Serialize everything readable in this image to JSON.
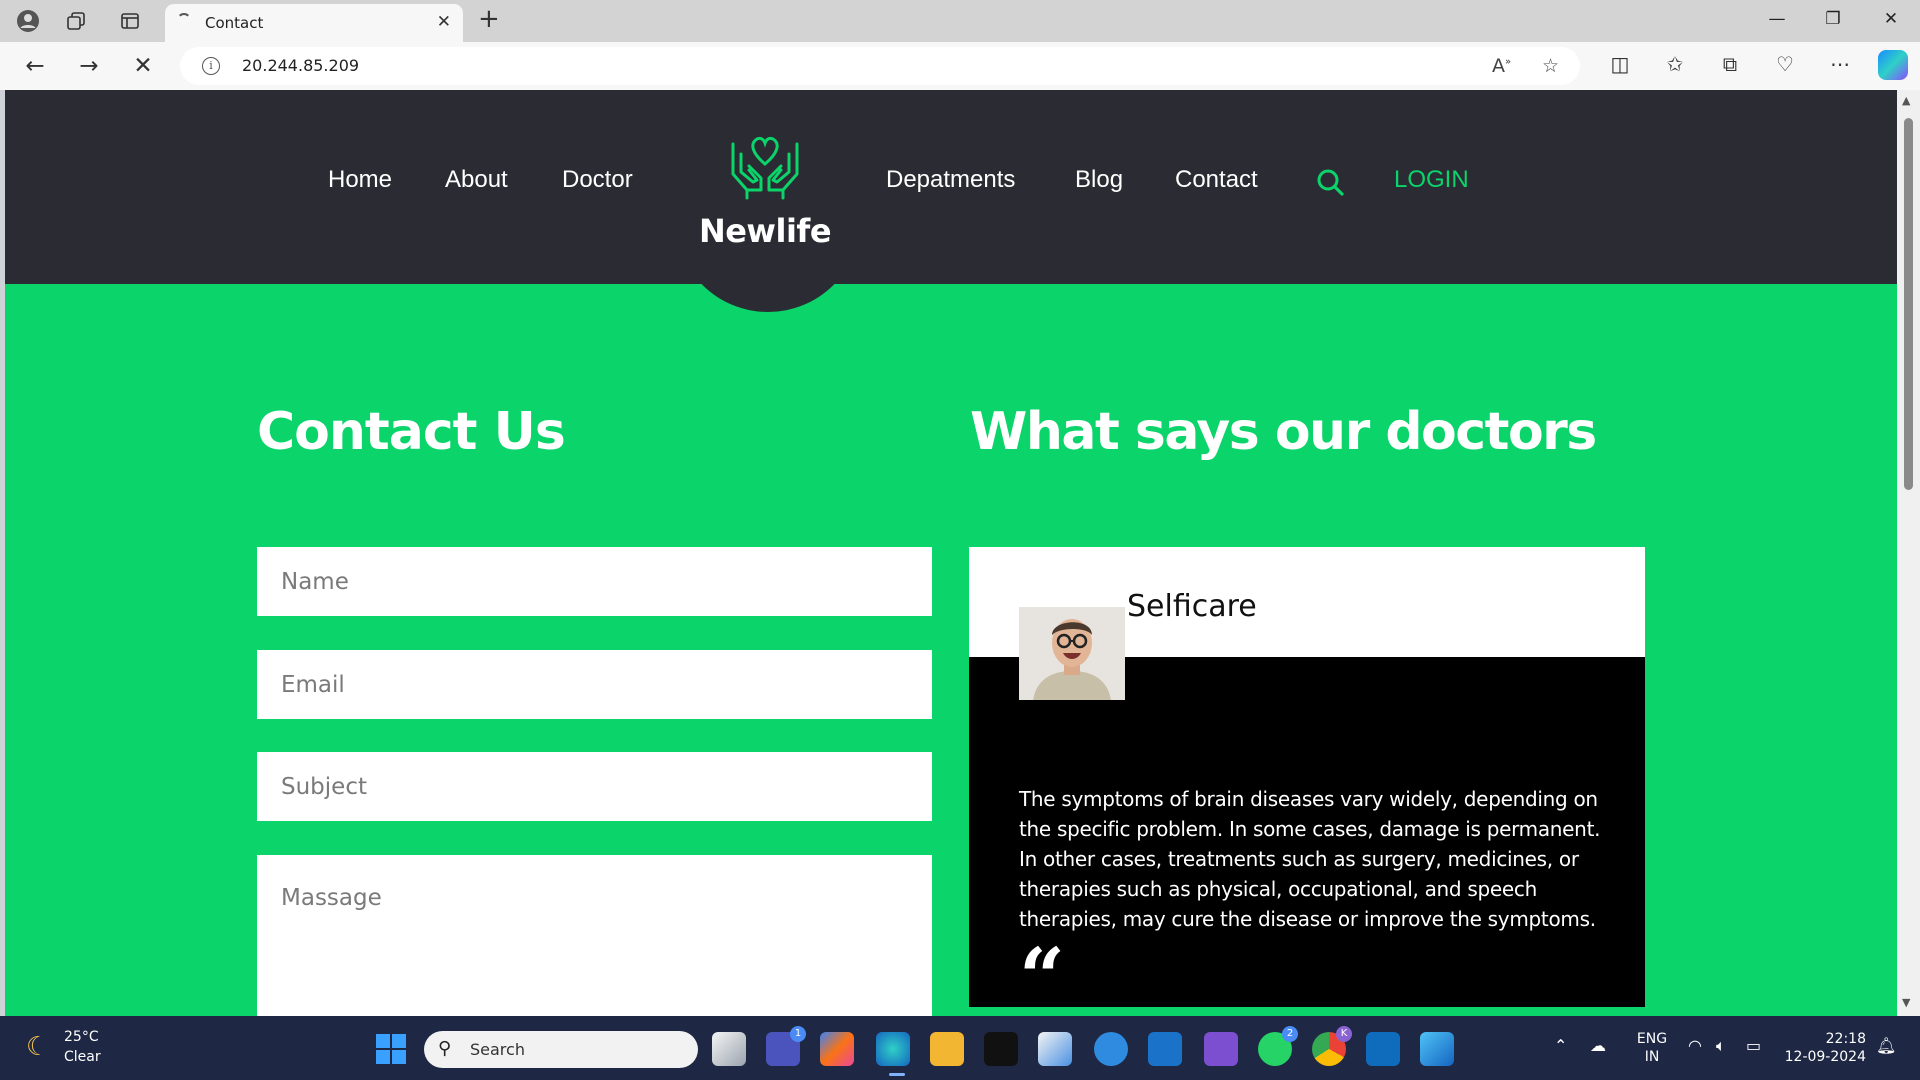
{
  "browser": {
    "tab_title": "Contact",
    "url": "20.244.85.209"
  },
  "site": {
    "logo_text": "Newlife",
    "nav_left": [
      "Home",
      "About",
      "Doctor"
    ],
    "nav_right": [
      "Depatments",
      "Blog",
      "Contact"
    ],
    "login_label": "LOGIN",
    "accent_color": "#0ad46a",
    "header_color": "#2b2c33"
  },
  "contact": {
    "heading": "Contact Us",
    "name_placeholder": "Name",
    "email_placeholder": "Email",
    "subject_placeholder": "Subject",
    "message_placeholder": "Massage"
  },
  "testimonials": {
    "heading": "What says our doctors",
    "name": "Selficare",
    "text": "The symptoms of brain diseases vary widely, depending on the specific problem. In some cases, damage is permanent. In other cases, treatments such as surgery, medicines, or therapies such as physical, occupational, and speech therapies, may cure the disease or improve the symptoms.",
    "quote_glyph": "“"
  },
  "taskbar": {
    "weather_temp": "25°C",
    "weather_cond": "Clear",
    "search_label": "Search",
    "lang_line1": "ENG",
    "lang_line2": "IN",
    "time": "22:18",
    "date": "12-09-2024",
    "teams_badge": "1",
    "whatsapp_badge": "2",
    "chrome_badge": "K"
  }
}
